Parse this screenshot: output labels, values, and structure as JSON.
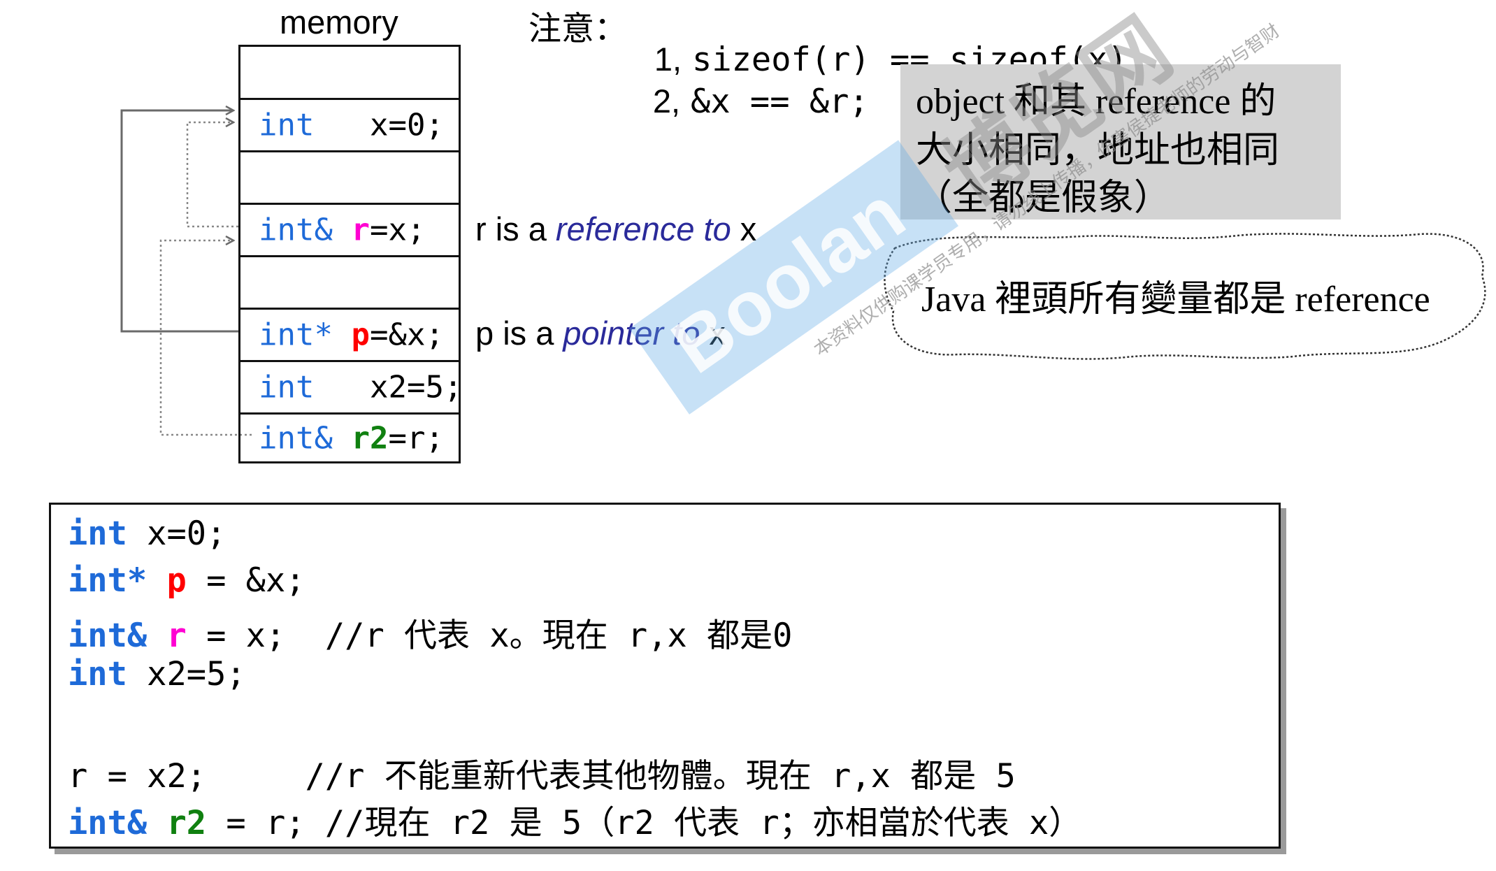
{
  "memory": {
    "title": "memory",
    "cells": [
      {
        "kw": "",
        "name": "",
        "rest": ""
      },
      {
        "kw": "int",
        "name": "",
        "rest": "x=0;"
      },
      {
        "kw": "",
        "name": "",
        "rest": ""
      },
      {
        "kw": "int&",
        "name": "r",
        "rest": "=x;"
      },
      {
        "kw": "",
        "name": "",
        "rest": ""
      },
      {
        "kw": "int*",
        "name": "p",
        "rest": "=&x;"
      },
      {
        "kw": "int",
        "name": "",
        "rest": "x2=5;"
      },
      {
        "kw": "int&",
        "name": "r2",
        "rest": "=r;"
      }
    ]
  },
  "notes": {
    "prefix": "注意：",
    "line1_num": "1,",
    "line1_code": "sizeof(r) == sizeof(x)",
    "line2_num": "2,",
    "line2_code": "&x == &r;"
  },
  "labels": {
    "r_pre": "r is a ",
    "r_em": "reference to",
    "r_post": " x",
    "p_pre": "p is a ",
    "p_em": "pointer to",
    "p_post": " x"
  },
  "gray_box": {
    "line1": "object 和其 reference 的",
    "line2": "大小相同，地址也相同",
    "line3": "（全都是假象）"
  },
  "cloud": {
    "text": "Java 裡頭所有變量都是 reference"
  },
  "code": {
    "l1_kw": "int",
    "l1_rest": " x=0;",
    "l2_kw": "int*",
    "l2_name": "p",
    "l2_rest": " = &x;",
    "l3_kw": "int&",
    "l3_name": "r",
    "l3_rest": " = x;  //r 代表 x。現在 r,x 都是0",
    "l4_kw": "int",
    "l4_rest": " x2=5;",
    "l5_rest": "r = x2;     //r 不能重新代表其他物體。現在 r,x 都是 5",
    "l6_kw": "int&",
    "l6_name": "r2",
    "l6_rest": " = r; //現在 r2 是 5（r2 代表 r；亦相當於代表 x）"
  },
  "watermark": {
    "logo": "Boolan",
    "brand": "博览网",
    "notice": "本资料仅供购课学员专用，请勿线上传播，伤害侯捷老师的劳动与智财"
  }
}
